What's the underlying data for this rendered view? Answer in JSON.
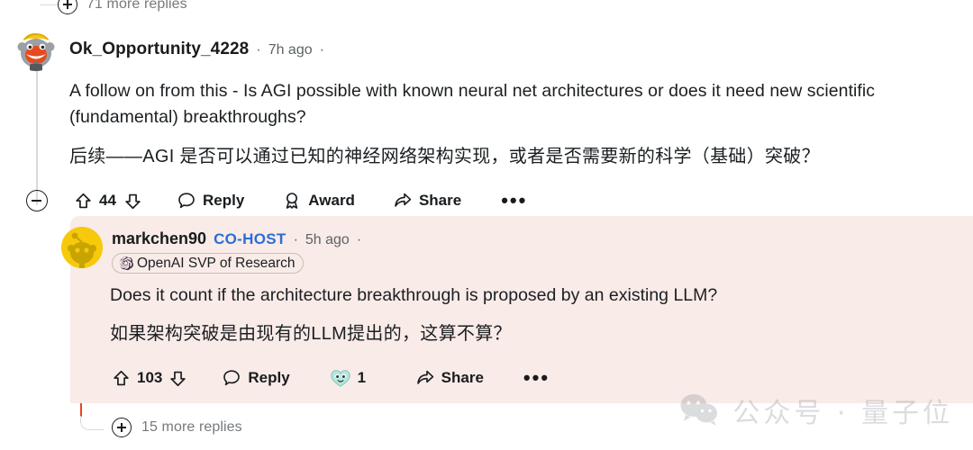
{
  "thread": {
    "top_more_replies": {
      "label": "71 more replies",
      "icon": "plus-circle-icon"
    },
    "comment_level1": {
      "author": "Ok_Opportunity_4228",
      "separator1": "·",
      "time": "7h ago",
      "separator2": "·",
      "body_en": "A follow on from this - Is AGI possible with known neural net architectures or does it need new scientific (fundamental) breakthroughs?",
      "body_zh": "后续——AGI 是否可以通过已知的神经网络架构实现，或者是否需要新的科学（基础）突破？",
      "actions": {
        "collapse": "collapse-thread-button",
        "upvote": "upvote-icon",
        "score": "44",
        "downvote": "downvote-icon",
        "reply": "Reply",
        "award": "Award",
        "share": "Share",
        "overflow": "•••"
      }
    },
    "comment_level2": {
      "author": "markchen90",
      "badge": "CO-HOST",
      "separator1": "·",
      "time": "5h ago",
      "separator2": "·",
      "flair": "OpenAI SVP of Research",
      "flair_icon": "openai-logo-icon",
      "body_en": "Does it count if the architecture breakthrough is proposed by an existing LLM?",
      "body_zh": "如果架构突破是由现有的LLM提出的，这算不算？",
      "actions": {
        "upvote": "upvote-icon",
        "score": "103",
        "downvote": "downvote-icon",
        "reply": "Reply",
        "award_count": "1",
        "award_icon": "heart-eyes-award-icon",
        "share": "Share",
        "overflow": "•••"
      }
    },
    "bottom_more_replies": {
      "label": "15 more replies",
      "icon": "plus-circle-icon"
    }
  },
  "watermark": {
    "text": "公众号 · 量子位",
    "icon": "wechat-icon"
  },
  "colors": {
    "nested_background": "#f9ebe7",
    "thread_line_accent": "#e8441f",
    "cohost_badge": "#2a6ed4",
    "avatar_level2": "#f7c90b"
  }
}
